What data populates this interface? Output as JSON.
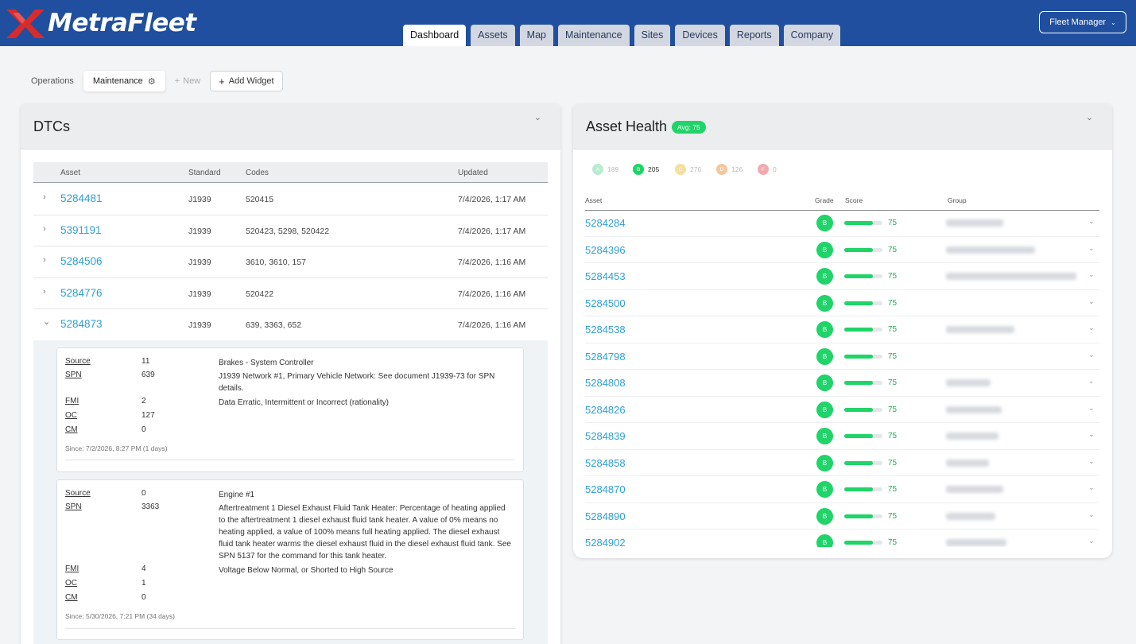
{
  "app": {
    "brand": "MetraFleet"
  },
  "nav": {
    "tabs": [
      "Dashboard",
      "Assets",
      "Map",
      "Maintenance",
      "Sites",
      "Devices",
      "Reports",
      "Company"
    ],
    "active": 0
  },
  "user": {
    "label": "Fleet Manager"
  },
  "dashboards": {
    "operations": "Operations",
    "maintenance": "Maintenance",
    "new": "New",
    "add_widget": "Add Widget"
  },
  "dtcs": {
    "title": "DTCs",
    "columns": {
      "asset": "Asset",
      "standard": "Standard",
      "codes": "Codes",
      "updated": "Updated"
    },
    "rows": [
      {
        "asset": "5284481",
        "standard": "J1939",
        "codes": "520415",
        "updated": "7/4/2026, 1:17 AM"
      },
      {
        "asset": "5391191",
        "standard": "J1939",
        "codes": "520423, 5298, 520422",
        "updated": "7/4/2026, 1:17 AM"
      },
      {
        "asset": "5284506",
        "standard": "J1939",
        "codes": "3610, 3610, 157",
        "updated": "7/4/2026, 1:16 AM"
      },
      {
        "asset": "5284776",
        "standard": "J1939",
        "codes": "520422",
        "updated": "7/4/2026, 1:16 AM"
      },
      {
        "asset": "5284873",
        "standard": "J1939",
        "codes": "639, 3363, 652",
        "updated": "7/4/2026, 1:16 AM"
      }
    ],
    "labels": {
      "source": "Source",
      "spn": "SPN",
      "fmi": "FMI",
      "oc": "OC",
      "cm": "CM"
    },
    "faults": [
      {
        "source": "11",
        "source_desc": "Brakes - System Controller",
        "spn": "639",
        "spn_desc": "J1939 Network #1, Primary Vehicle Network: See document J1939-73 for SPN details.",
        "fmi": "2",
        "fmi_desc": "Data Erratic, Intermittent or Incorrect (rationality)",
        "oc": "127",
        "cm": "0",
        "since": "Since: 7/2/2026, 8:27 PM (1 days)"
      },
      {
        "source": "0",
        "source_desc": "Engine #1",
        "spn": "3363",
        "spn_desc": "Aftertreatment 1 Diesel Exhaust Fluid Tank Heater: Percentage of heating applied to the aftertreatment 1 diesel exhaust fluid tank heater. A value of 0% means no heating applied, a value of 100% means full heating applied. The diesel exhaust fluid tank heater warms the diesel exhaust fluid in the diesel exhaust fluid tank. See SPN 5137 for the command for this tank heater.",
        "fmi": "4",
        "fmi_desc": "Voltage Below Normal, or Shorted to High Source",
        "oc": "1",
        "cm": "0",
        "since": "Since: 5/30/2026, 7:21 PM (34 days)"
      }
    ]
  },
  "asset_health": {
    "title": "Asset Health",
    "avg": "Avg: 75",
    "grades": [
      {
        "grade": "A",
        "count": "189",
        "color": "#b7ecd0"
      },
      {
        "grade": "B",
        "count": "205",
        "color": "#1fd468"
      },
      {
        "grade": "C",
        "count": "276",
        "color": "#f5dfa0"
      },
      {
        "grade": "D",
        "count": "126",
        "color": "#f5c79d"
      },
      {
        "grade": "F",
        "count": "0",
        "color": "#f3a9ad"
      }
    ],
    "columns": {
      "asset": "Asset",
      "grade": "Grade",
      "score": "Score",
      "group": "Group"
    },
    "rows": [
      {
        "asset": "5284284",
        "grade": "B",
        "score": "75",
        "score_fraction": 0.75
      },
      {
        "asset": "5284396",
        "grade": "B",
        "score": "75",
        "score_fraction": 0.75
      },
      {
        "asset": "5284453",
        "grade": "B",
        "score": "75",
        "score_fraction": 0.75
      },
      {
        "asset": "5284500",
        "grade": "B",
        "score": "75",
        "score_fraction": 0.75
      },
      {
        "asset": "5284538",
        "grade": "B",
        "score": "75",
        "score_fraction": 0.75
      },
      {
        "asset": "5284798",
        "grade": "B",
        "score": "75",
        "score_fraction": 0.75
      },
      {
        "asset": "5284808",
        "grade": "B",
        "score": "75",
        "score_fraction": 0.75
      },
      {
        "asset": "5284826",
        "grade": "B",
        "score": "75",
        "score_fraction": 0.75
      },
      {
        "asset": "5284839",
        "grade": "B",
        "score": "75",
        "score_fraction": 0.75
      },
      {
        "asset": "5284858",
        "grade": "B",
        "score": "75",
        "score_fraction": 0.75
      },
      {
        "asset": "5284870",
        "grade": "B",
        "score": "75",
        "score_fraction": 0.75
      },
      {
        "asset": "5284890",
        "grade": "B",
        "score": "75",
        "score_fraction": 0.75
      },
      {
        "asset": "5284902",
        "grade": "B",
        "score": "75",
        "score_fraction": 0.75
      }
    ]
  },
  "colors": {
    "header": "#1f4f9e",
    "link": "#2e9fd6",
    "grade_b": "#1fd468",
    "logo_mark": "#d92b2b"
  },
  "icons": {
    "gear": "gear-icon",
    "plus": "plus-icon",
    "chevron_down": "chevron-down-icon",
    "chevron_right": "chevron-right-icon"
  }
}
